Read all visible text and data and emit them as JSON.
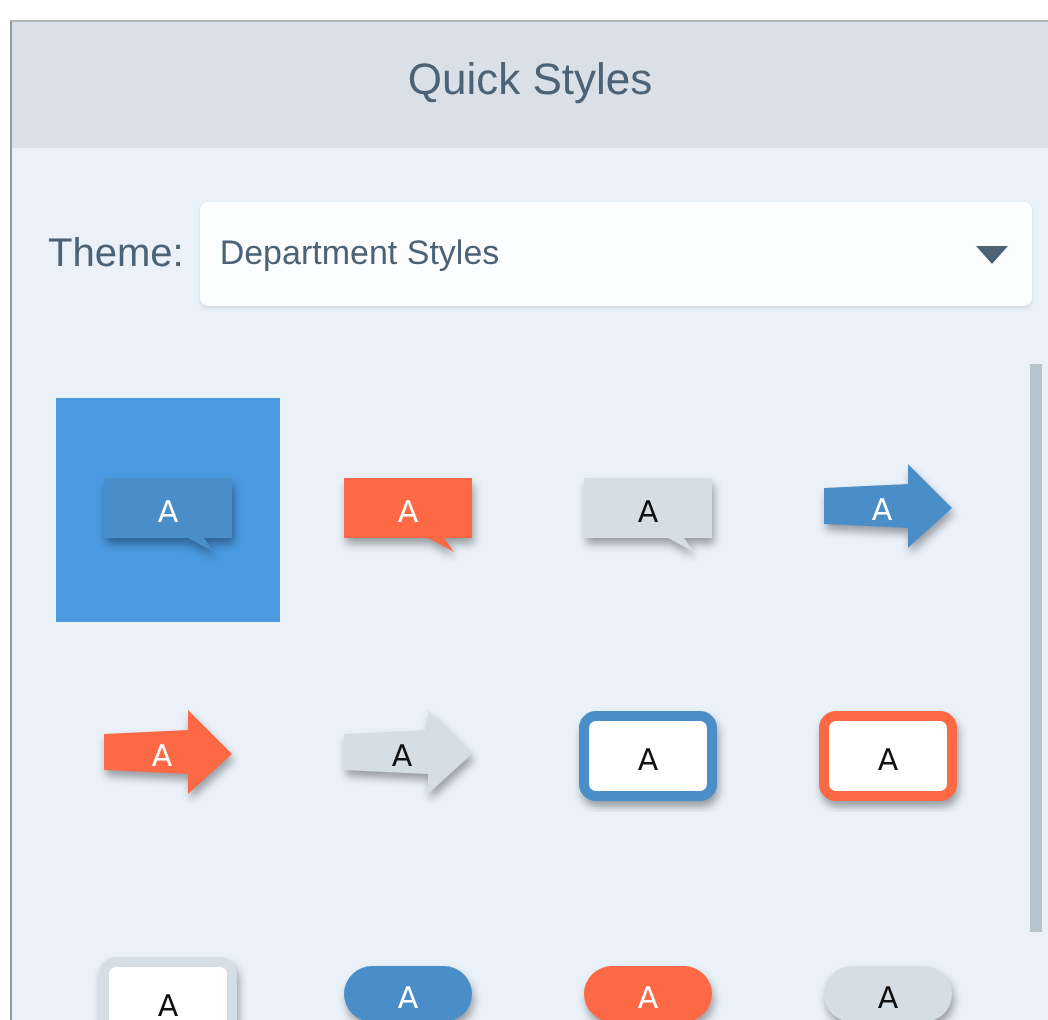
{
  "panel": {
    "title": "Quick Styles"
  },
  "theme": {
    "label": "Theme:",
    "value": "Department Styles"
  },
  "styles": [
    {
      "kind": "callout",
      "color": "#4a8ec9",
      "label": "A",
      "selected": true
    },
    {
      "kind": "callout",
      "color": "#fd6845",
      "label": "A",
      "selected": false
    },
    {
      "kind": "callout",
      "color": "#d5dde5",
      "label": "A",
      "selected": false
    },
    {
      "kind": "arrow",
      "color": "#4a8ec9",
      "label": "A",
      "selected": false
    },
    {
      "kind": "arrow",
      "color": "#fd6845",
      "label": "A",
      "selected": false
    },
    {
      "kind": "arrow",
      "color": "#d5dde5",
      "label": "A",
      "selected": false
    },
    {
      "kind": "framed",
      "color": "#4a8ec9",
      "label": "A",
      "selected": false
    },
    {
      "kind": "framed",
      "color": "#fd6845",
      "label": "A",
      "selected": false
    },
    {
      "kind": "framed",
      "color": "#d5dde5",
      "label": "A",
      "selected": false
    },
    {
      "kind": "pill",
      "color": "#4a8ec9",
      "label": "A",
      "selected": false
    },
    {
      "kind": "pill",
      "color": "#fd6845",
      "label": "A",
      "selected": false
    },
    {
      "kind": "pill",
      "color": "#d5dde5",
      "label": "A",
      "selected": false
    }
  ]
}
